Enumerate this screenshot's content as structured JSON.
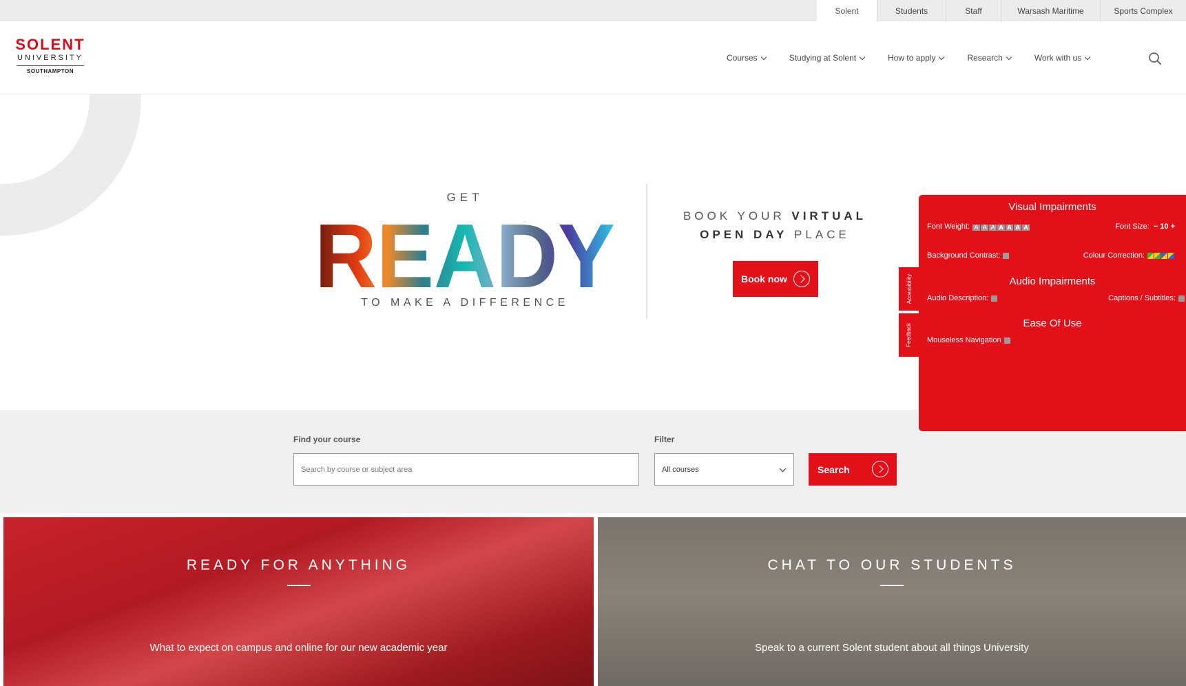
{
  "utility_tabs": [
    "Solent",
    "Students",
    "Staff",
    "Warsash Maritime",
    "Sports Complex"
  ],
  "logo": {
    "line1": "SOLENT",
    "line2": "UNIVERSITY",
    "line3": "SOUTHAMPTON"
  },
  "nav": [
    "Courses",
    "Studying at Solent",
    "How to apply",
    "Research",
    "Work with us"
  ],
  "search_icon": "search-icon",
  "hero": {
    "get": "GET",
    "ready": "READY",
    "tagline": "TO MAKE A DIFFERENCE",
    "book_line1_pre": "BOOK YOUR ",
    "book_line1_bold": "VIRTUAL",
    "book_line2_bold": "OPEN DAY",
    "book_line2_post": " PLACE",
    "book_button": "Book now"
  },
  "finder": {
    "course_label": "Find your course",
    "course_placeholder": "Search by course or subject area",
    "filter_label": "Filter",
    "filter_value": "All courses",
    "search_button": "Search"
  },
  "cards": [
    {
      "title": "READY FOR ANYTHING",
      "subtitle": "What to expect on campus and online for our new academic year"
    },
    {
      "title": "CHAT TO OUR STUDENTS",
      "subtitle": "Speak to a current Solent student about all things University"
    }
  ],
  "accessibility": {
    "side_tabs": [
      "Accessibility",
      "Feedback"
    ],
    "visual_heading": "Visual Impairments",
    "font_weight_label": "Font Weight:",
    "font_weight_glyph": "A",
    "font_size_label": "Font Size:",
    "font_size_control": "− 10 +",
    "background_contrast_label": "Background Contrast:",
    "colour_correction_label": "Colour Correction:",
    "audio_heading": "Audio Impairments",
    "audio_description_label": "Audio Description:",
    "captions_label": "Captions / Subtitles:",
    "ease_heading": "Ease Of Use",
    "mouseless_label": "Mouseless Navigation"
  },
  "colors": {
    "brand_red": "#e3101a",
    "logo_red": "#d4101c",
    "panel_grey": "#efefef"
  }
}
